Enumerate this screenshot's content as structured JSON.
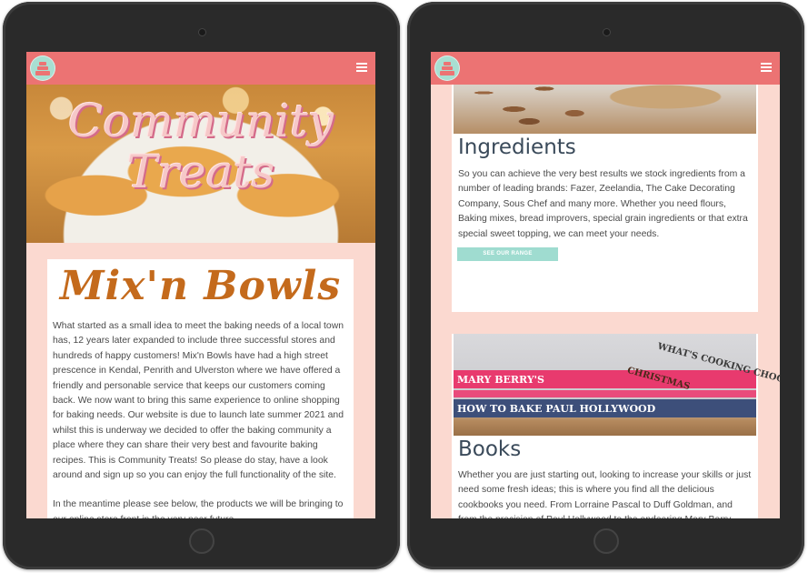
{
  "navbar": {
    "menu_icon": "hamburger-icon",
    "logo_icon": "cake-logo-icon"
  },
  "left": {
    "hero": {
      "line1": "Community",
      "line2": "Treats"
    },
    "about": {
      "title": "Mix'n Bowls",
      "para1": "What started as a small idea to meet the baking needs of a local town has, 12 years later expanded to include three successful stores and hundreds of happy customers! Mix'n Bowls have had a high street prescence in Kendal, Penrith and Ulverston where we have offered a friendly and personable service that keeps our customers coming back. We now want to bring this same experience to online shopping for baking needs. Our website is due to launch late summer 2021 and whilst this is underway we decided to offer the baking community a place where they can share their very best and favourite baking recipes. This is Community Treats! So please do stay, have a look around and sign up so you can enjoy the full functionality of the site.",
      "para2": "In the meantime please see below, the products we will be bringing to our online store front in the very near future."
    }
  },
  "right": {
    "ingredients": {
      "title": "Ingredients",
      "body": "So you can achieve the very best results we stock ingredients from a number of leading brands: Fazer, Zeelandia, The Cake Decorating Company, Sous Chef and many more. Whether you need flours, Baking mixes, bread improvers, special grain ingredients or that extra special sweet topping, we can meet your needs.",
      "button": "SEE OUR RANGE"
    },
    "books": {
      "title": "Books",
      "body": "Whether you are just starting out, looking to increase your skills or just need some fresh ideas; this is where you find all the delicious cookbooks you need. From Lorraine Pascal to Duff Goldman, and from the precision of Paul Hollywood to the endearing Mary Berry, explore",
      "spine1": "MARY BERRY'S",
      "spine2": "HOW TO BAKE  PAUL HOLLYWOOD",
      "spine3": "CHRISTMAS",
      "spine4": "WHAT'S COOKING  CHOCO"
    }
  },
  "colors": {
    "navbar": "#ec7373",
    "page_bg": "#fbd9d0",
    "accent_button": "#9fdcd0",
    "brand_title": "#c46a1c"
  }
}
